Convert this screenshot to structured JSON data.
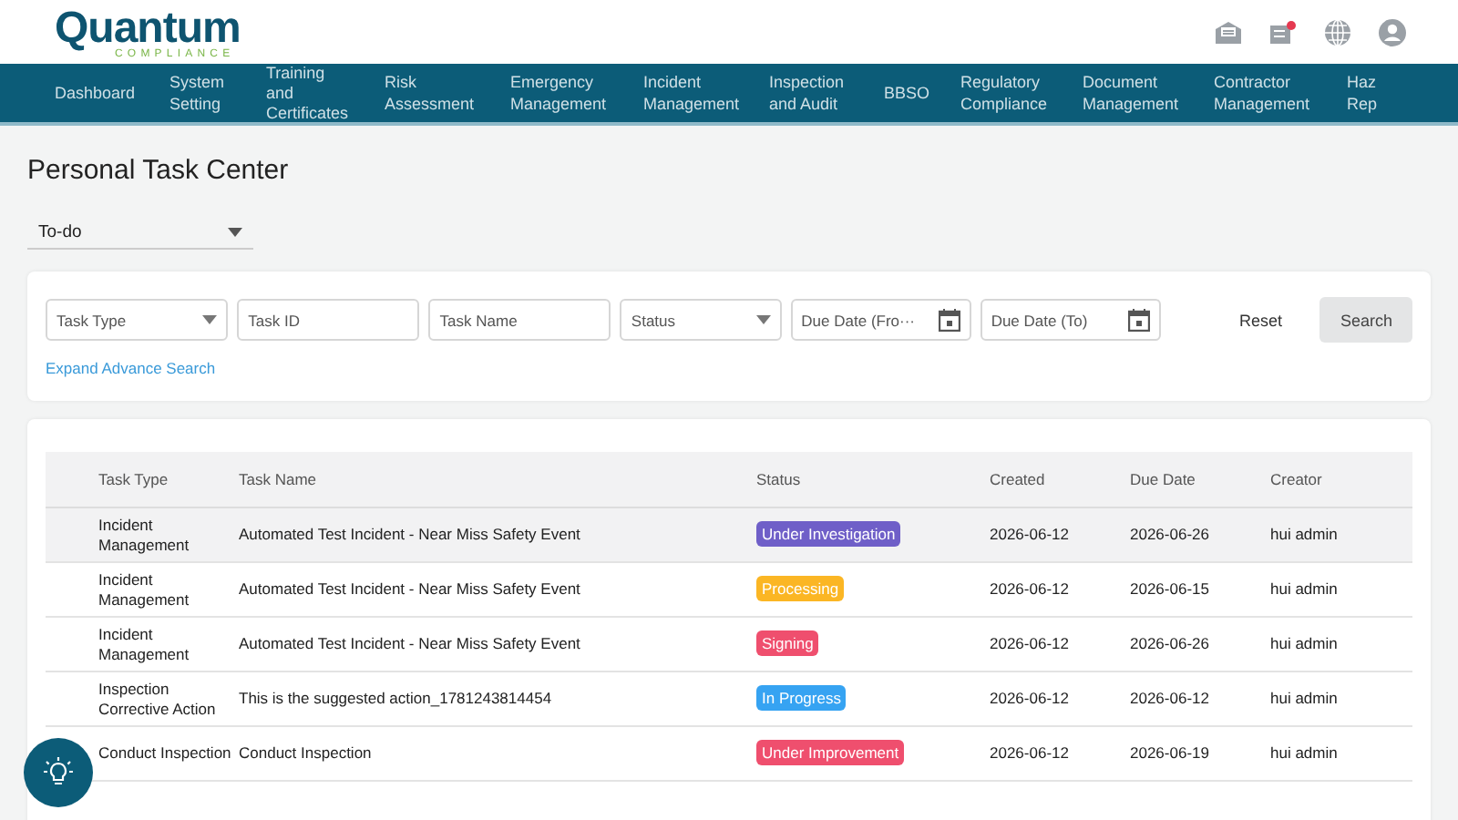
{
  "logo": {
    "name": "Quantum",
    "tagline": "COMPLIANCE"
  },
  "nav": [
    {
      "label": "Dashboard"
    },
    {
      "label": "System Setting"
    },
    {
      "label": "Training and Certificates"
    },
    {
      "label": "Risk Assessment"
    },
    {
      "label": "Emergency Management"
    },
    {
      "label": "Incident Management"
    },
    {
      "label": "Inspection and Audit"
    },
    {
      "label": "BBSO"
    },
    {
      "label": "Regulatory Compliance"
    },
    {
      "label": "Document Management"
    },
    {
      "label": "Contractor Management"
    },
    {
      "label": "Haz Rep"
    }
  ],
  "page_title": "Personal Task Center",
  "view_select": {
    "value": "To-do"
  },
  "filters": [
    {
      "kind": "select",
      "placeholder": "Task Type"
    },
    {
      "kind": "input",
      "placeholder": "Task ID"
    },
    {
      "kind": "input",
      "placeholder": "Task Name"
    },
    {
      "kind": "select",
      "placeholder": "Status"
    },
    {
      "kind": "date",
      "placeholder": "Due Date (Fro···"
    },
    {
      "kind": "date",
      "placeholder": "Due Date (To)"
    }
  ],
  "reset_button": "Reset",
  "search_button": "Search",
  "expand_link": "Expand Advance Search",
  "table": {
    "columns": [
      "Task Type",
      "Task Name",
      "Status",
      "Created",
      "Due Date",
      "Creator"
    ],
    "rows": [
      {
        "selected": true,
        "task_type": "Incident Management",
        "task_name": "Automated Test Incident - Near Miss Safety Event",
        "status": "Under Investigation",
        "color": "#6f5fc8",
        "created": "2026-06-12",
        "due_date": "2026-06-26",
        "creator": "hui admin"
      },
      {
        "selected": false,
        "task_type": "Incident Management",
        "task_name": "Automated Test Incident - Near Miss Safety Event",
        "status": "Processing",
        "color": "#fbb624",
        "created": "2026-06-12",
        "due_date": "2026-06-15",
        "creator": "hui admin"
      },
      {
        "selected": false,
        "task_type": "Incident Management",
        "task_name": "Automated Test Incident - Near Miss Safety Event",
        "status": "Signing",
        "color": "#ef4f6e",
        "created": "2026-06-12",
        "due_date": "2026-06-26",
        "creator": "hui admin"
      },
      {
        "selected": false,
        "task_type": "Inspection Corrective Action",
        "task_name": "This is the suggested action_1781243814454",
        "status": "In Progress",
        "color": "#36a3f2",
        "created": "2026-06-12",
        "due_date": "2026-06-12",
        "creator": "hui admin"
      },
      {
        "selected": false,
        "task_type": "Conduct Inspection",
        "task_name": "Conduct Inspection",
        "status": "Under Improvement",
        "color": "#ef4f6e",
        "created": "2026-06-12",
        "due_date": "2026-06-19",
        "creator": "hui admin"
      }
    ]
  }
}
